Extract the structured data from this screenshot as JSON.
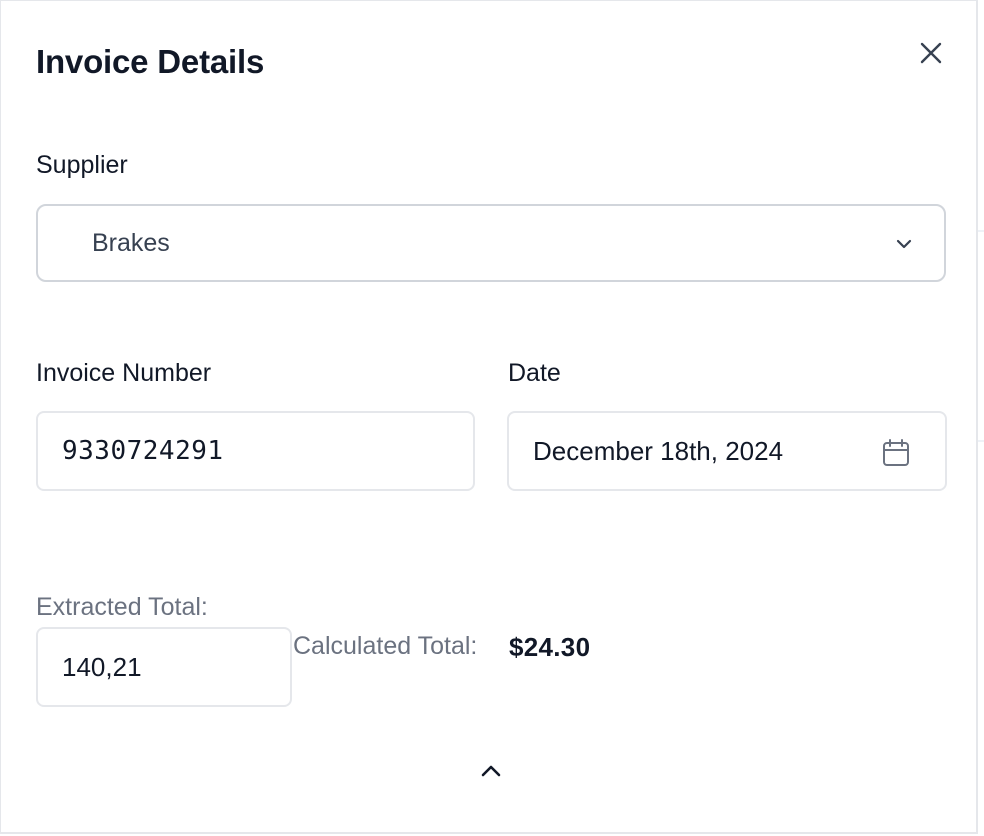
{
  "panel": {
    "title": "Invoice Details",
    "close_icon": "close-icon"
  },
  "supplier": {
    "label": "Supplier",
    "selected": "Brakes",
    "icon": "chevron-down-icon"
  },
  "invoice_number": {
    "label": "Invoice Number",
    "value": "9330724291"
  },
  "date": {
    "label": "Date",
    "value": "December 18th, 2024",
    "icon": "calendar-icon"
  },
  "totals": {
    "extracted_label": "Extracted Total:",
    "extracted_value": "140,21",
    "calculated_label": "Calculated Total:",
    "calculated_value": "$24.30"
  },
  "footer": {
    "collapse_icon": "chevron-up-icon"
  },
  "colors": {
    "border": "#d1d5db",
    "text": "#111827",
    "muted": "#6b7280"
  }
}
